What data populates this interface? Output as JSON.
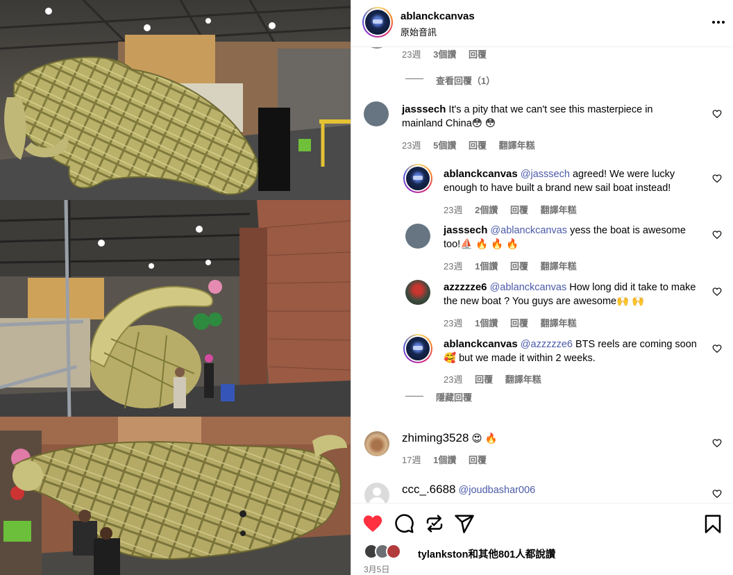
{
  "post": {
    "username": "ablanckcanvas",
    "audio": "原始音訊",
    "more_icon": "more-horizontal-icon"
  },
  "comments_top": {
    "partial_meta": {
      "time": "23週",
      "likes": "3個讚",
      "reply": "回覆"
    },
    "view_replies": "查看回覆（1）"
  },
  "comment_jasssech": {
    "username": "jasssech",
    "text": "It's a pity that we can't see this masterpiece in mainland China😳 😳",
    "time": "23週",
    "likes": "5個讚",
    "reply": "回覆",
    "translate": "翻譯年糕"
  },
  "replies": [
    {
      "username": "ablanckcanvas",
      "mention": "@jasssech",
      "text": " agreed! We were lucky enough to have built a brand new sail boat instead!",
      "time": "23週",
      "likes": "2個讚",
      "reply": "回覆",
      "translate": "翻譯年糕"
    },
    {
      "username": "jasssech",
      "mention": "@ablanckcanvas",
      "text": " yess the boat is awesome too!⛵ 🔥 🔥 🔥",
      "time": "23週",
      "likes": "1個讚",
      "reply": "回覆",
      "translate": "翻譯年糕"
    },
    {
      "username": "azzzzze6",
      "mention": "@ablanckcanvas",
      "text": " How long did it take to make the new boat ? You guys are awesome🙌 🙌",
      "time": "23週",
      "likes": "1個讚",
      "reply": "回覆",
      "translate": "翻譯年糕"
    },
    {
      "username": "ablanckcanvas",
      "mention": "@azzzzze6",
      "text": " BTS reels are coming soon 🥰  but we made it within 2 weeks.",
      "time": "23週",
      "likes": "",
      "reply": "回覆",
      "translate": "翻譯年糕"
    }
  ],
  "hide_replies": "隱藏回覆",
  "comment_zhiming": {
    "username": "zhiming3528",
    "text": "😍 🔥",
    "time": "17週",
    "likes": "1個讚",
    "reply": "回覆"
  },
  "comment_ccc": {
    "username": "ccc_.6688",
    "mention": "@joudbashar006"
  },
  "actions": {
    "like_icon": "heart-filled-icon",
    "comment_icon": "comment-icon",
    "share_icon": "repost-icon",
    "send_icon": "send-icon",
    "save_icon": "bookmark-icon"
  },
  "likes_text": "tylankston和其他801人都說讚",
  "date": "3月5日",
  "colors": {
    "like_red": "#ff3040",
    "meta_gray": "#737373",
    "mention_blue": "#4a5aa8"
  }
}
